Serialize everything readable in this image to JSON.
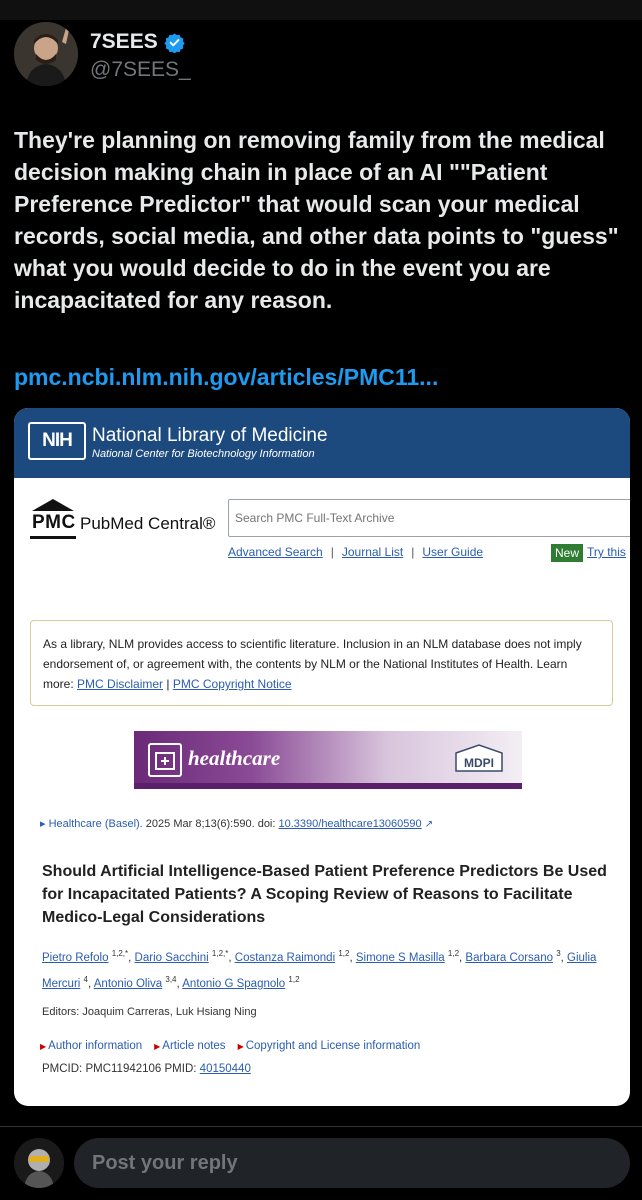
{
  "author": {
    "name": "7SEES",
    "handle": "@7SEES_"
  },
  "tweet": {
    "text": "They're planning on removing family from the medical decision making chain in place of an AI \"\"Patient Preference Predictor\" that would scan your medical records, social media, and other data points to \"guess\" what you would decide to do in the event you are incapacitated for any reason.",
    "link": "pmc.ncbi.nlm.nih.gov/articles/PMC11..."
  },
  "card": {
    "nih_logo": "NIH",
    "nih_title": "National Library of Medicine",
    "nih_subtitle": "National Center for Biotechnology Information",
    "pmc_word": "PMC",
    "pmc_name": "PubMed Central®",
    "search_placeholder": "Search PMC Full-Text Archive",
    "links": {
      "advanced": "Advanced Search",
      "journal": "Journal List",
      "guide": "User Guide"
    },
    "new_badge": "New",
    "try_link": "Try this",
    "disclaimer": {
      "text": "As a library, NLM provides access to scientific literature. Inclusion in an NLM database does not imply endorsement of, or agreement with, the contents by NLM or the National Institutes of Health.",
      "learn_more": "Learn more:",
      "disclaimer_link": "PMC Disclaimer",
      "sep": "|",
      "copyright_link": "PMC Copyright Notice"
    },
    "banner": {
      "word": "healthcare",
      "publisher": "MDPI"
    },
    "citation": {
      "journal": "Healthcare (Basel).",
      "details": "2025 Mar 8;13(6):590. doi:",
      "doi": "10.3390/healthcare13060590"
    },
    "article_title": "Should Artificial Intelligence-Based Patient Preference Predictors Be Used for Incapacitated Patients? A Scoping Review of Reasons to Facilitate Medico-Legal Considerations",
    "authors": [
      {
        "name": "Pietro Refolo",
        "sup": "1,2,*"
      },
      {
        "name": "Dario Sacchini",
        "sup": "1,2,*"
      },
      {
        "name": "Costanza Raimondi",
        "sup": "1,2"
      },
      {
        "name": "Simone S Masilla",
        "sup": "1,2"
      },
      {
        "name": "Barbara Corsano",
        "sup": "3"
      },
      {
        "name": "Giulia Mercuri",
        "sup": "4"
      },
      {
        "name": "Antonio Oliva",
        "sup": "3,4"
      },
      {
        "name": "Antonio G Spagnolo",
        "sup": "1,2"
      }
    ],
    "editors": "Editors: Joaquim Carreras, Luk Hsiang Ning",
    "info_links": {
      "author_info": "Author information",
      "article_notes": "Article notes",
      "copyright": "Copyright and License information"
    },
    "pmcid_label": "PMCID: PMC11942106",
    "pmid_label": "PMID:",
    "pmid": "40150440"
  },
  "reply": {
    "placeholder": "Post your reply"
  },
  "colors": {
    "background": "#000000",
    "link_blue": "#1d9bf0",
    "nih_blue": "#1d4a7e",
    "pmc_link": "#2a5db0",
    "new_green": "#2e7d32"
  }
}
